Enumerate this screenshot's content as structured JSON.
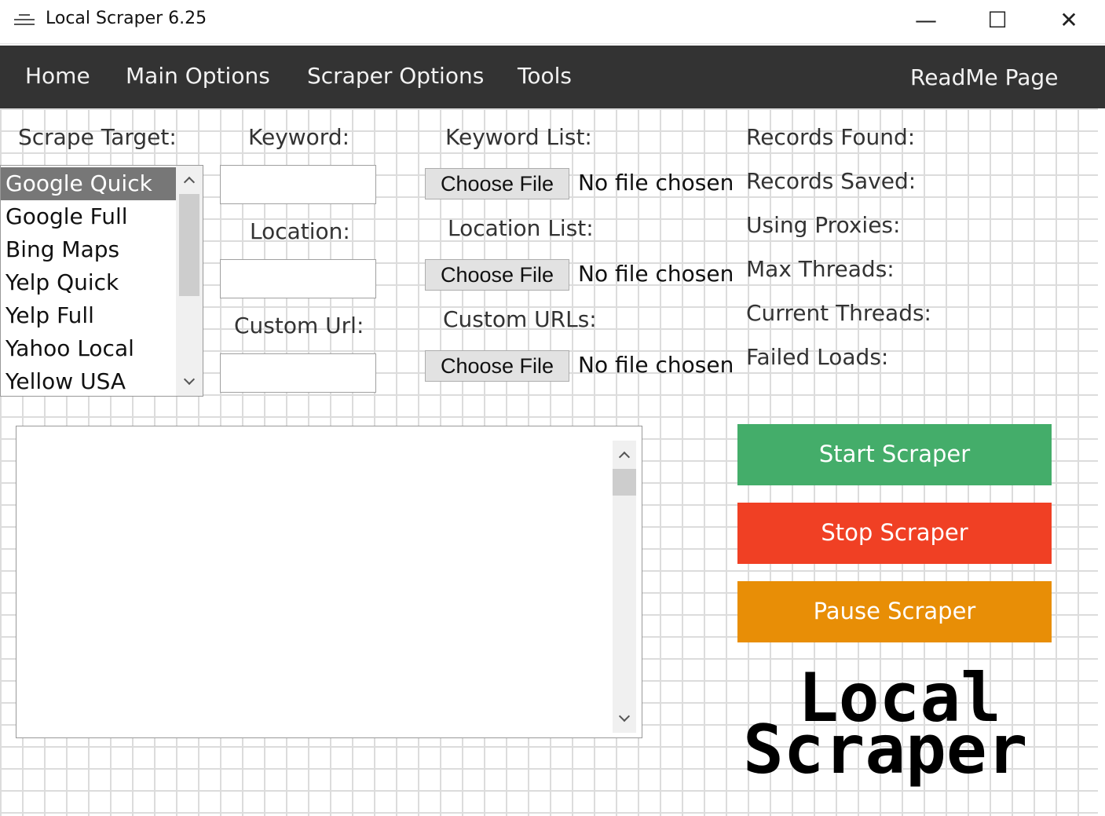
{
  "window": {
    "title": "Local Scraper 6.25",
    "minimize_glyph": "—",
    "maximize_glyph": "☐",
    "close_glyph": "✕"
  },
  "nav": {
    "items": [
      "Home",
      "Main Options",
      "Scraper Options",
      "Tools"
    ],
    "readme": "ReadMe Page"
  },
  "form": {
    "scrape_target_label": "Scrape Target:",
    "targets": [
      "Google Quick",
      "Google Full",
      "Bing Maps",
      "Yelp Quick",
      "Yelp Full",
      "Yahoo Local",
      "Yellow USA"
    ],
    "selected_target": "Google Quick",
    "keyword_label": "Keyword:",
    "keyword_value": "",
    "location_label": "Location:",
    "location_value": "",
    "custom_url_label": "Custom Url:",
    "custom_url_value": "",
    "keyword_list_label": "Keyword List:",
    "location_list_label": "Location List:",
    "custom_urls_label": "Custom URLs:",
    "choose_file_label": "Choose File",
    "no_file_label": "No file chosen"
  },
  "stats": {
    "records_found": "Records Found:",
    "records_saved": "Records Saved:",
    "using_proxies": "Using Proxies:",
    "max_threads": "Max Threads:",
    "current_threads": "Current Threads:",
    "failed_loads": "Failed Loads:"
  },
  "log": {
    "text": ""
  },
  "buttons": {
    "start": "Start Scraper",
    "stop": "Stop Scraper",
    "pause": "Pause Scraper"
  },
  "logo": {
    "line1": "Local",
    "line2": "Scraper"
  },
  "colors": {
    "nav_bg": "#333333",
    "start": "#44ad6a",
    "stop": "#f04024",
    "pause": "#e88e06",
    "selected_item": "#777777"
  }
}
